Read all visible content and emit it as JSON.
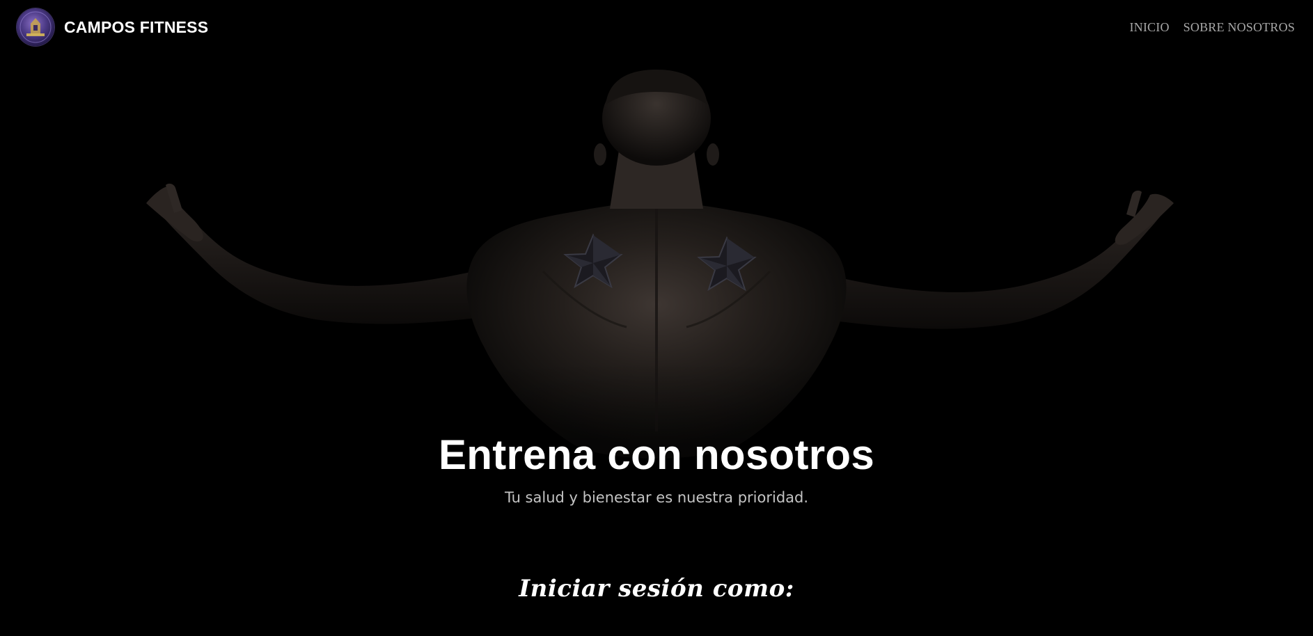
{
  "brand": {
    "name": "CAMPOS FITNESS",
    "logo_icon": "gym-logo-icon"
  },
  "nav": {
    "items": [
      {
        "label": "INICIO"
      },
      {
        "label": "SOBRE NOSOTROS"
      }
    ]
  },
  "hero": {
    "title": "Entrena con nosotros",
    "subtitle": "Tu salud y bienestar es nuestra prioridad.",
    "background_image": "athlete-back-silhouette"
  },
  "login": {
    "heading": "Iniciar sesión como:"
  },
  "colors": {
    "background": "#000000",
    "text_primary": "#ffffff",
    "text_muted": "#c4c4c4",
    "nav_link": "#a8a8a8",
    "logo_accent": "#4c3a86"
  }
}
